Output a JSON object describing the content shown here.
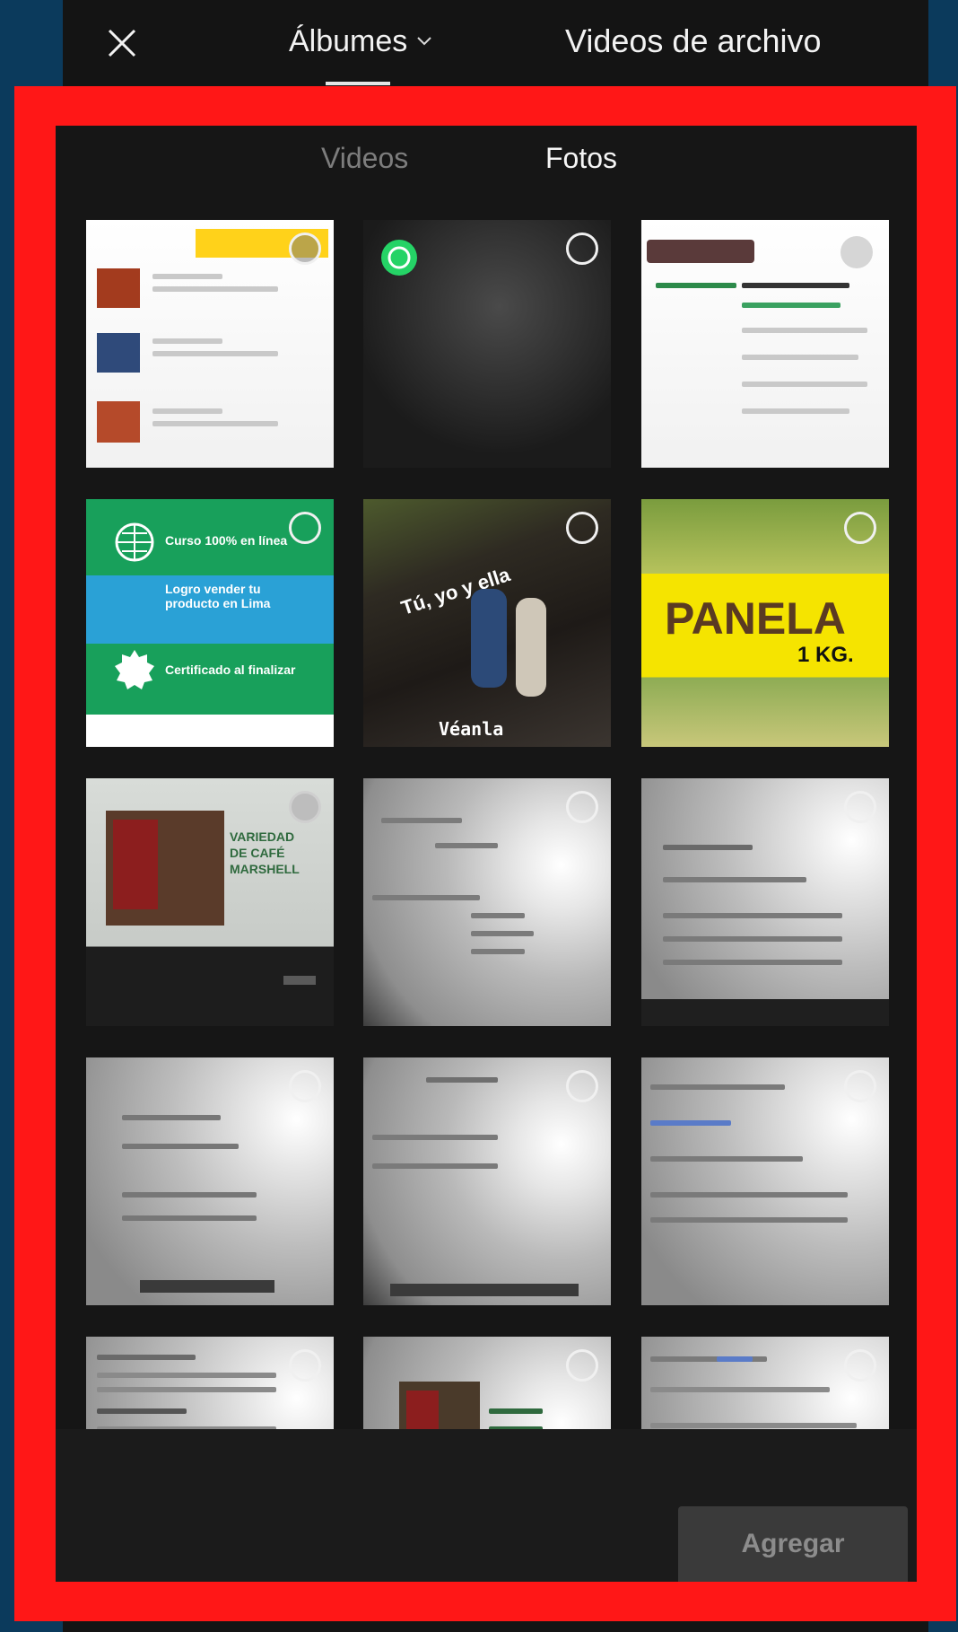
{
  "header": {
    "album_label": "Álbumes",
    "archive_label": "Videos de archivo"
  },
  "subtabs": {
    "videos": "Videos",
    "photos": "Fotos"
  },
  "tiles_text": {
    "green_course": "Curso 100% en línea",
    "green_sell": "Logro vender tu producto en Lima",
    "green_cert": "Certificado al finalizar",
    "street_title": "Tú, yo y ella",
    "street_caption": "Véanla",
    "panela_title": "PANELA",
    "panela_weight": "1 KG.",
    "coffee_title": "VARIEDAD DE CAFÉ MARSHELL"
  },
  "footer": {
    "add_label": "Agregar"
  },
  "colors": {
    "outline": "#ff1717",
    "bg": "#141414",
    "selected_tab": "#f5f5f5",
    "unselected_tab": "#7d7d7d"
  }
}
